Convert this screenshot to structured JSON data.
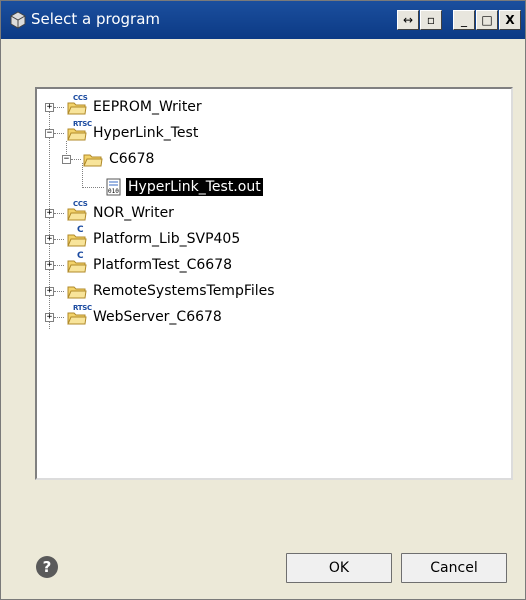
{
  "window": {
    "title": "Select a program",
    "controls": {
      "restore": "↔",
      "pin": "▫",
      "minimize": "_",
      "maximize": "□",
      "close": "X"
    }
  },
  "tree": {
    "items": [
      {
        "label": "EEPROM_Writer",
        "badge": "CCS",
        "expanded": false
      },
      {
        "label": "HyperLink_Test",
        "badge": "RTSC",
        "expanded": true,
        "children": [
          {
            "label": "C6678",
            "expanded": true,
            "children": [
              {
                "label": "HyperLink_Test.out",
                "selected": true
              }
            ]
          }
        ]
      },
      {
        "label": "NOR_Writer",
        "badge": "CCS",
        "expanded": false
      },
      {
        "label": "Platform_Lib_SVP405",
        "badge": "C",
        "expanded": false
      },
      {
        "label": "PlatformTest_C6678",
        "badge": "C",
        "expanded": false
      },
      {
        "label": "RemoteSystemsTempFiles",
        "badge": "",
        "expanded": false
      },
      {
        "label": "WebServer_C6678",
        "badge": "RTSC",
        "expanded": false
      }
    ]
  },
  "footer": {
    "help": "?",
    "ok_label": "OK",
    "cancel_label": "Cancel"
  },
  "colors": {
    "titlebar": "#0c3a85",
    "folder": "#f3d36b",
    "selection": "#000000"
  }
}
